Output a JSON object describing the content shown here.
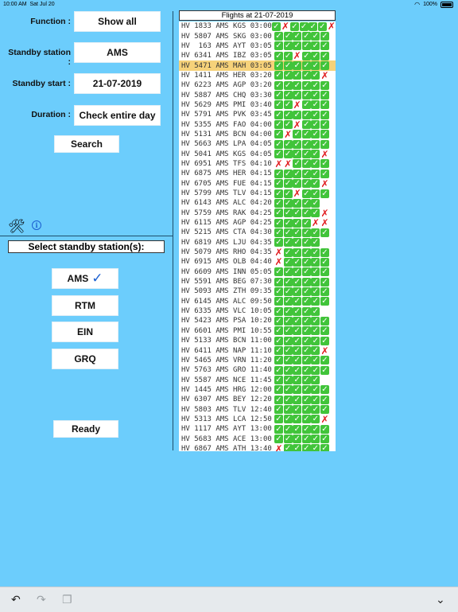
{
  "status": {
    "time": "10:00 AM",
    "date": "Sat Jul 20",
    "battery": "100%"
  },
  "form": {
    "function_label": "Function :",
    "function_value": "Show all",
    "station_label": "Standby station :",
    "station_value": "AMS",
    "start_label": "Standby start :",
    "start_value": "21-07-2019",
    "duration_label": "Duration :",
    "duration_value": "Check entire day",
    "search_label": "Search"
  },
  "stations": {
    "header": "Select standby station(s):",
    "items": [
      {
        "code": "AMS",
        "selected": true
      },
      {
        "code": "RTM",
        "selected": false
      },
      {
        "code": "EIN",
        "selected": false
      },
      {
        "code": "GRQ",
        "selected": false
      }
    ],
    "ready_label": "Ready"
  },
  "flights": {
    "title": "Flights at 21-07-2019",
    "rows": [
      {
        "text": "HV 1833 AMS KGS 03:00",
        "marks": "1011110"
      },
      {
        "text": "HV 5807 AMS SKG 03:00",
        "marks": "111111"
      },
      {
        "text": "HV  163 AMS AYT 03:05",
        "marks": "111111"
      },
      {
        "text": "HV 6341 AMS IBZ 03:05",
        "marks": "110111"
      },
      {
        "text": "HV 5471 AMS MAH 03:05",
        "marks": "111111",
        "selected": true
      },
      {
        "text": "HV 1411 AMS HER 03:20",
        "marks": "111110"
      },
      {
        "text": "HV 6223 AMS AGP 03:20",
        "marks": "111111"
      },
      {
        "text": "HV 5887 AMS CHQ 03:30",
        "marks": "111111"
      },
      {
        "text": "HV 5629 AMS PMI 03:40",
        "marks": "110111"
      },
      {
        "text": "HV 5791 AMS PVK 03:45",
        "marks": "111111"
      },
      {
        "text": "HV 5355 AMS FAO 04:00",
        "marks": "110111"
      },
      {
        "text": "HV 5131 AMS BCN 04:00",
        "marks": "101111"
      },
      {
        "text": "HV 5663 AMS LPA 04:05",
        "marks": "111111"
      },
      {
        "text": "HV 5041 AMS KGS 04:05",
        "marks": "111110"
      },
      {
        "text": "HV 6951 AMS TFS 04:10",
        "marks": "001111"
      },
      {
        "text": "HV 6875 AMS HER 04:15",
        "marks": "111111"
      },
      {
        "text": "HV 6705 AMS FUE 04:15",
        "marks": "111110"
      },
      {
        "text": "HV 5799 AMS TLV 04:15",
        "marks": "110111"
      },
      {
        "text": "HV 6143 AMS ALC 04:20",
        "marks": "11111"
      },
      {
        "text": "HV 5759 AMS RAK 04:25",
        "marks": "111110"
      },
      {
        "text": "HV 6115 AMS AGP 04:25",
        "marks": "111100"
      },
      {
        "text": "HV 5215 AMS CTA 04:30",
        "marks": "111111"
      },
      {
        "text": "HV 6819 AMS LJU 04:35",
        "marks": "11111"
      },
      {
        "text": "HV 5079 AMS RHO 04:35",
        "marks": "011111"
      },
      {
        "text": "HV 6915 AMS OLB 04:40",
        "marks": "011111"
      },
      {
        "text": "HV 6609 AMS INN 05:05",
        "marks": "111111"
      },
      {
        "text": "HV 5591 AMS BEG 07:30",
        "marks": "111111"
      },
      {
        "text": "HV 5093 AMS ZTH 09:35",
        "marks": "111111"
      },
      {
        "text": "HV 6145 AMS ALC 09:50",
        "marks": "111111"
      },
      {
        "text": "HV 6335 AMS VLC 10:05",
        "marks": "11111"
      },
      {
        "text": "HV 5423 AMS PSA 10:20",
        "marks": "111111"
      },
      {
        "text": "HV 6601 AMS PMI 10:55",
        "marks": "111111"
      },
      {
        "text": "HV 5133 AMS BCN 11:00",
        "marks": "111111"
      },
      {
        "text": "HV 6411 AMS NAP 11:10",
        "marks": "111110"
      },
      {
        "text": "HV 5465 AMS VRN 11:20",
        "marks": "111111"
      },
      {
        "text": "HV 5763 AMS GRO 11:40",
        "marks": "111111"
      },
      {
        "text": "HV 5587 AMS NCE 11:45",
        "marks": "11111"
      },
      {
        "text": "HV 1445 AMS HRG 12:00",
        "marks": "111111"
      },
      {
        "text": "HV 6307 AMS BEY 12:20",
        "marks": "111111"
      },
      {
        "text": "HV 5803 AMS TLV 12:40",
        "marks": "111111"
      },
      {
        "text": "HV 5313 AMS LCA 12:50",
        "marks": "111110"
      },
      {
        "text": "HV 1117 AMS AYT 13:00",
        "marks": "111111"
      },
      {
        "text": "HV 5683 AMS ACE 13:00",
        "marks": "111111"
      },
      {
        "text": "HV 6867 AMS ATH 13:40",
        "marks": "011111"
      }
    ]
  },
  "colors": {
    "background": "#6ccdfc",
    "ok": "#41c43a",
    "fail": "#e0191c",
    "selected_row": "#f6d27a"
  }
}
